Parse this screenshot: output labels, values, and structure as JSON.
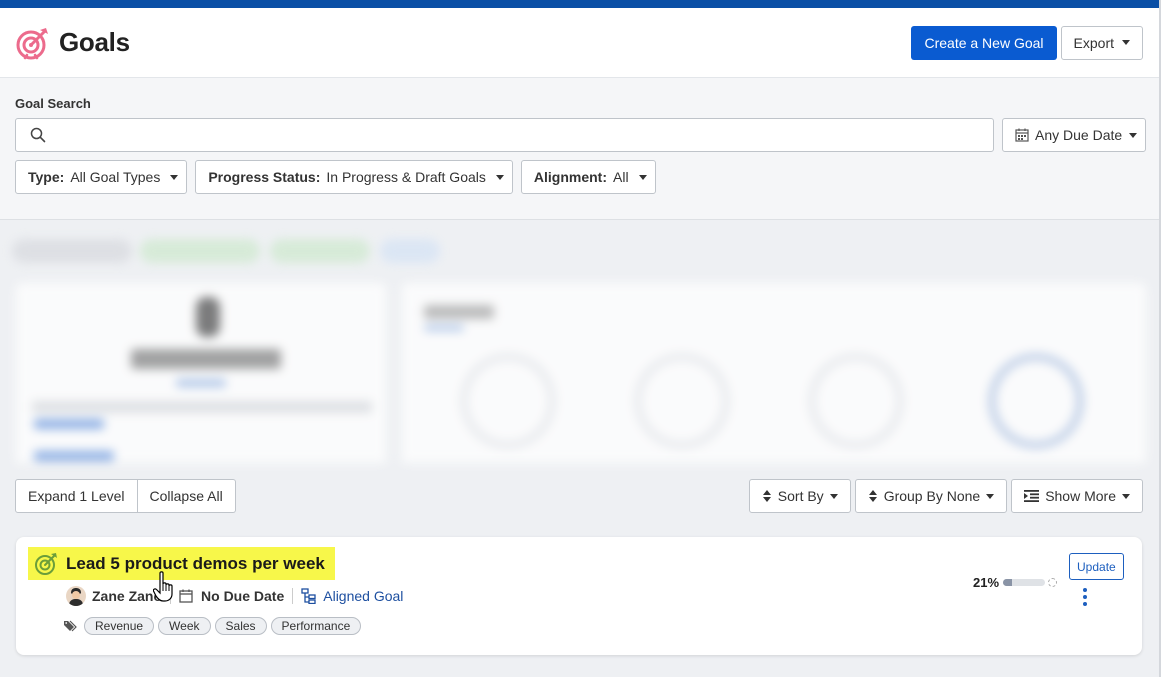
{
  "header": {
    "title": "Goals",
    "create_label": "Create a New Goal",
    "export_label": "Export"
  },
  "search": {
    "label": "Goal Search",
    "value": "",
    "placeholder": "",
    "due_date": "Any Due Date"
  },
  "filters": [
    {
      "key": "Type:",
      "value": "All Goal Types"
    },
    {
      "key": "Progress Status:",
      "value": "In Progress & Draft Goals"
    },
    {
      "key": "Alignment:",
      "value": "All"
    }
  ],
  "toolbar": {
    "expand_label": "Expand 1 Level",
    "collapse_label": "Collapse All",
    "sort_label": "Sort By",
    "group_label": "Group By None",
    "show_more_label": "Show More"
  },
  "goal": {
    "title": "Lead 5 product demos per week",
    "owner": "Zane Zano",
    "due": "No Due Date",
    "alignment": "Aligned Goal",
    "tags": [
      "Revenue",
      "Week",
      "Sales",
      "Performance"
    ],
    "progress_text": "21%",
    "progress": 0.21,
    "update_label": "Update"
  },
  "colors": {
    "brand": "#0a4fa6",
    "primary_button": "#0a5bd1",
    "highlight": "#f7f74a",
    "link": "#1d4fa0"
  }
}
